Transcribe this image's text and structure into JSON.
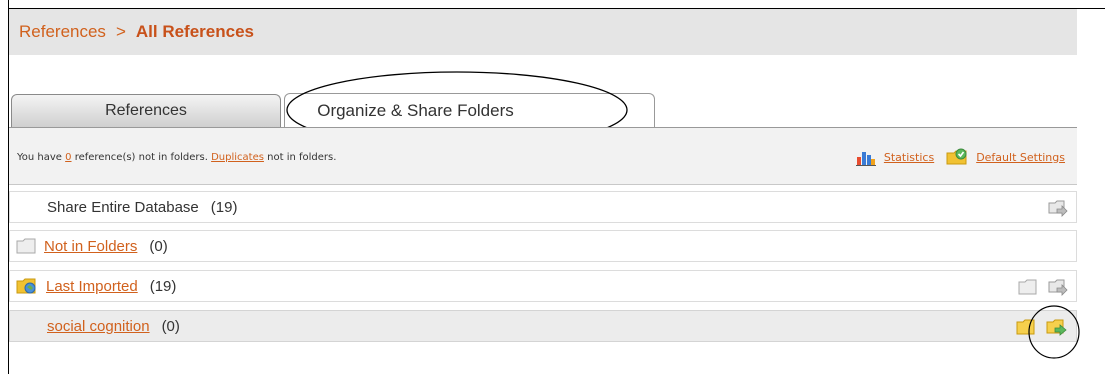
{
  "breadcrumb": {
    "root": "References",
    "separator": ">",
    "current": "All References"
  },
  "tabs": [
    {
      "label": "References",
      "active": false
    },
    {
      "label": "Organize & Share Folders",
      "active": true
    }
  ],
  "info": {
    "prefix": "You have ",
    "count": "0",
    "mid": " reference(s) not in folders. ",
    "duplicates_link": "Duplicates",
    "suffix": " not in folders.",
    "statistics": "Statistics",
    "default_settings": "Default Settings"
  },
  "rows": [
    {
      "name": "Share Entire Database",
      "count": "(19)"
    },
    {
      "name": "Not in Folders",
      "count": "(0)"
    },
    {
      "name": "Last Imported",
      "count": "(19)"
    },
    {
      "name": "social cognition",
      "count": "(0)"
    }
  ],
  "colors": {
    "link": "#d1611d",
    "breadcrumb_bg": "#e5e5e5",
    "highlight_row": "#ececec"
  }
}
